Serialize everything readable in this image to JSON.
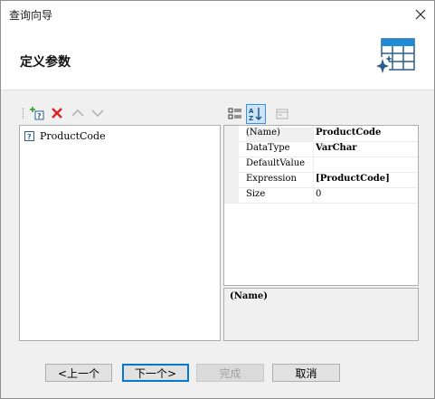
{
  "window": {
    "title": "查询向导"
  },
  "header": {
    "heading": "定义参数"
  },
  "left_pane": {
    "items": [
      {
        "label": "ProductCode"
      }
    ]
  },
  "properties": {
    "rows": [
      {
        "name": "(Name)",
        "value": "ProductCode"
      },
      {
        "name": "DataType",
        "value": "VarChar"
      },
      {
        "name": "DefaultValue",
        "value": ""
      },
      {
        "name": "Expression",
        "value": "[ProductCode]"
      },
      {
        "name": "Size",
        "value": "0"
      }
    ],
    "description_title": "(Name)"
  },
  "buttons": {
    "back": "<上一个",
    "next": "下一个>",
    "finish": "完成",
    "cancel": "取消"
  },
  "colors": {
    "accent": "#0078d7",
    "delete": "#e02020",
    "add": "#2a9d2a"
  }
}
